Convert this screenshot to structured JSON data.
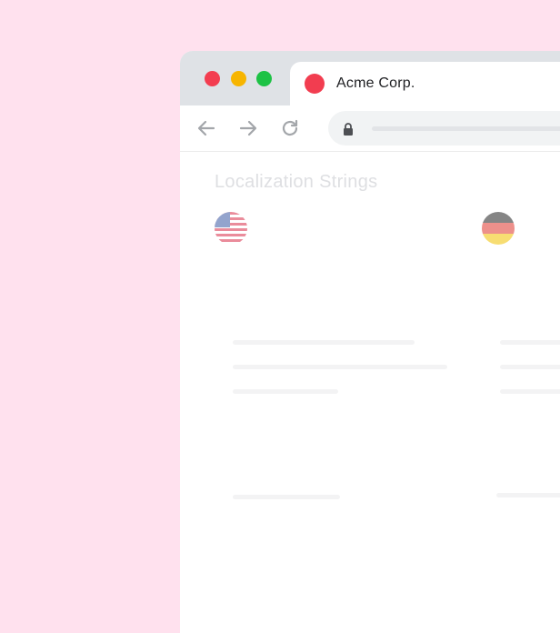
{
  "browser": {
    "tab": {
      "title": "Acme Corp."
    }
  },
  "page": {
    "title": "Localization Strings",
    "languages": [
      {
        "flag": "us-flag-icon"
      },
      {
        "flag": "de-flag-icon"
      }
    ]
  },
  "colors": {
    "background": "#ffe1ee",
    "close": "#f33d50",
    "minimize": "#f7b500",
    "maximize": "#1dc245",
    "favicon": "#f23d50"
  }
}
